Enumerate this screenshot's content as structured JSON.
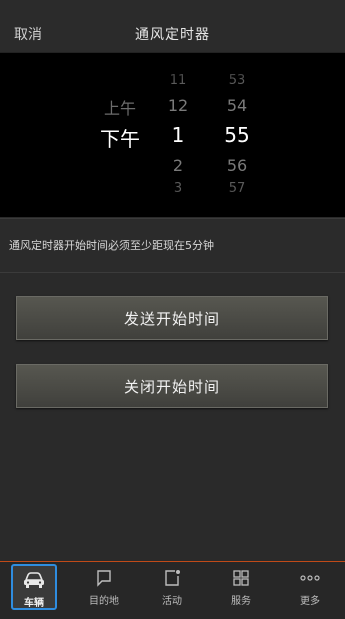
{
  "header": {
    "cancel": "取消",
    "title": "通风定时器"
  },
  "picker": {
    "ampm": [
      "上午",
      "下午"
    ],
    "ampm_selected": "下午",
    "hours": [
      "11",
      "12",
      "1",
      "2",
      "3"
    ],
    "hour_selected": "1",
    "minutes": [
      "53",
      "54",
      "55",
      "56",
      "57"
    ],
    "minute_selected": "55"
  },
  "hint": "通风定时器开始时间必须至少距现在5分钟",
  "buttons": {
    "send": "发送开始时间",
    "close": "关闭开始时间"
  },
  "tabs": [
    {
      "label": "车辆",
      "icon": "car-icon",
      "active": true
    },
    {
      "label": "目的地",
      "icon": "chat-bubble-icon",
      "active": false
    },
    {
      "label": "活动",
      "icon": "activity-icon",
      "active": false
    },
    {
      "label": "服务",
      "icon": "grid-icon",
      "active": false
    },
    {
      "label": "更多",
      "icon": "more-icon",
      "active": false
    }
  ],
  "colors": {
    "accent": "#2f8de0",
    "tab_divider": "#c04a18",
    "picker_bg": "#000000"
  }
}
